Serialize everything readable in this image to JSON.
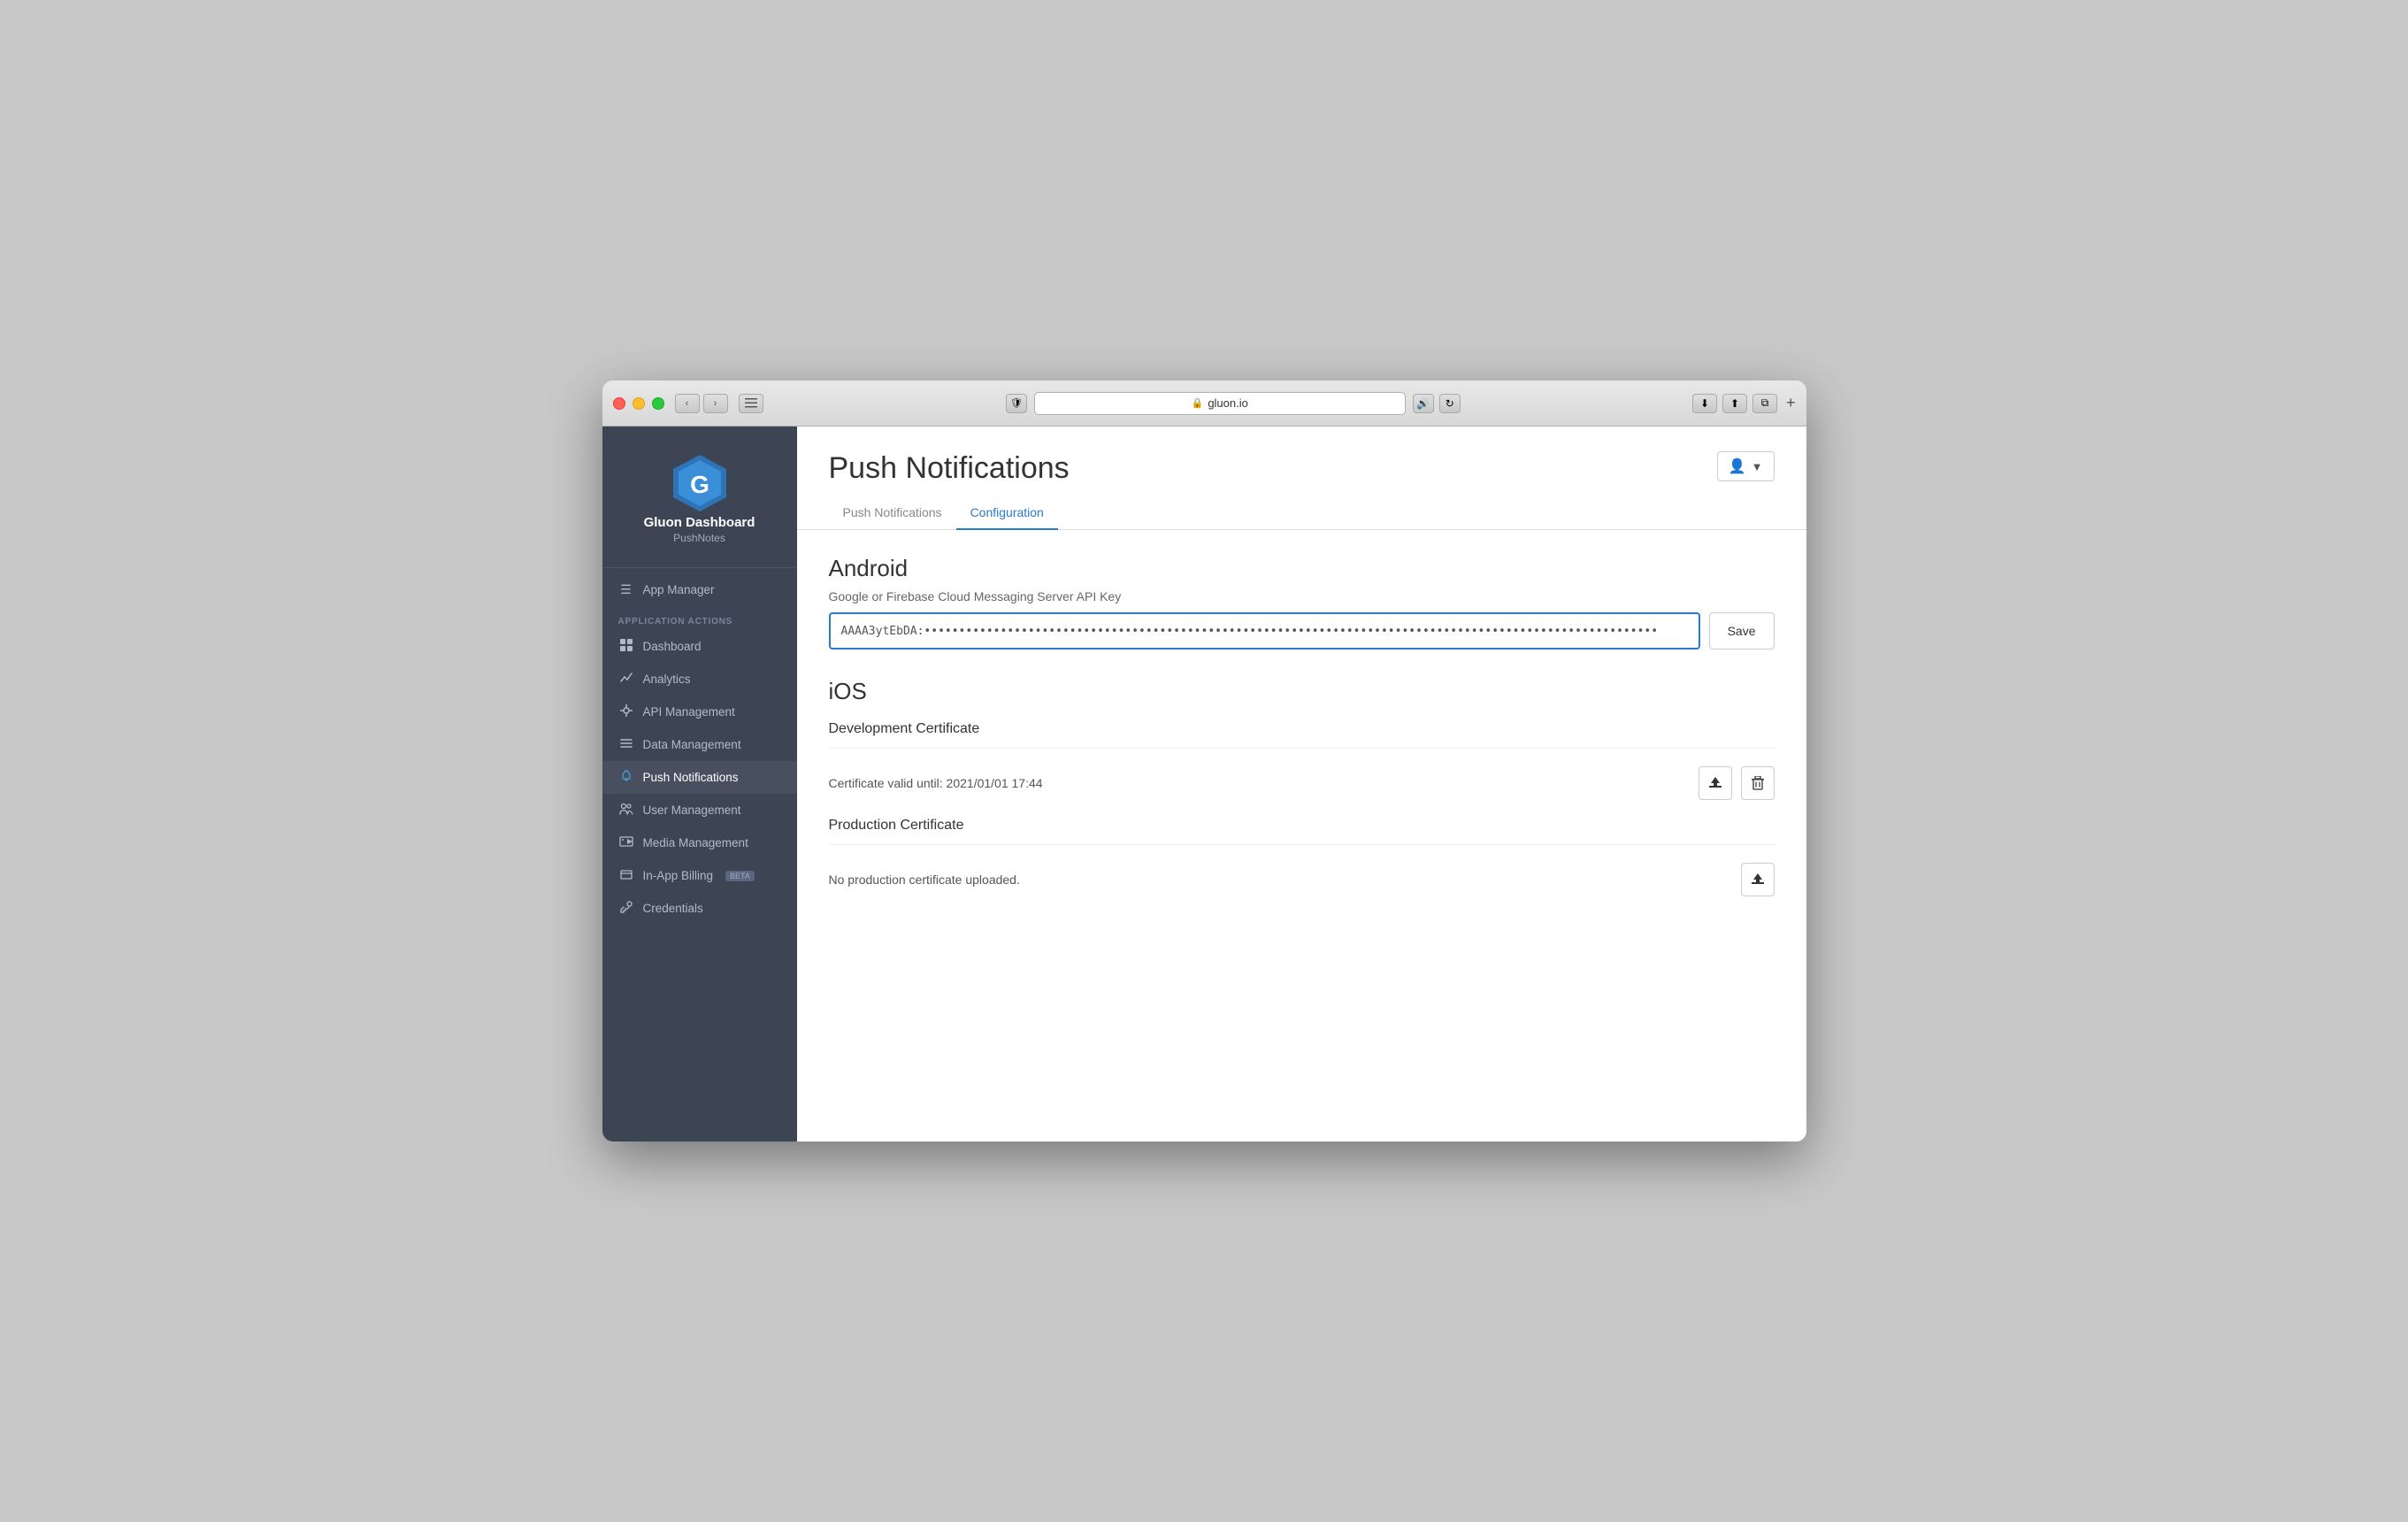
{
  "window": {
    "url": "gluon.io"
  },
  "sidebar": {
    "app_name": "Gluon Dashboard",
    "app_subtitle": "PushNotes",
    "section_label": "APPLICATION ACTIONS",
    "items": [
      {
        "id": "app-manager",
        "label": "App Manager",
        "icon": "☰",
        "active": false
      },
      {
        "id": "dashboard",
        "label": "Dashboard",
        "icon": "⊞",
        "active": false
      },
      {
        "id": "analytics",
        "label": "Analytics",
        "icon": "↗",
        "active": false
      },
      {
        "id": "api-management",
        "label": "API Management",
        "icon": "🔧",
        "active": false
      },
      {
        "id": "data-management",
        "label": "Data Management",
        "icon": "☰",
        "active": false
      },
      {
        "id": "push-notifications",
        "label": "Push Notifications",
        "icon": "🔔",
        "active": true
      },
      {
        "id": "user-management",
        "label": "User Management",
        "icon": "👥",
        "active": false
      },
      {
        "id": "media-management",
        "label": "Media Management",
        "icon": "📹",
        "active": false
      },
      {
        "id": "in-app-billing",
        "label": "In-App Billing",
        "icon": "💰",
        "active": false,
        "badge": "BETA"
      },
      {
        "id": "credentials",
        "label": "Credentials",
        "icon": "🔑",
        "active": false
      }
    ]
  },
  "header": {
    "page_title": "Push Notifications",
    "user_button_label": "▼"
  },
  "tabs": [
    {
      "id": "push-notifications-tab",
      "label": "Push Notifications",
      "active": false
    },
    {
      "id": "configuration-tab",
      "label": "Configuration",
      "active": true
    }
  ],
  "android_section": {
    "title": "Android",
    "field_label": "Google or Firebase Cloud Messaging Server API Key",
    "api_key_value": "AAAA3ytEbDA:••••••••••••••••••••••••••••••••••••••••••••••••••••••••••••••••••••••••••••••••••••••••••••••••••••••••••",
    "save_button": "Save"
  },
  "ios_section": {
    "title": "iOS",
    "dev_cert_title": "Development Certificate",
    "dev_cert_text": "Certificate valid until: 2021/01/01 17:44",
    "prod_cert_title": "Production Certificate",
    "prod_cert_text": "No production certificate uploaded."
  }
}
